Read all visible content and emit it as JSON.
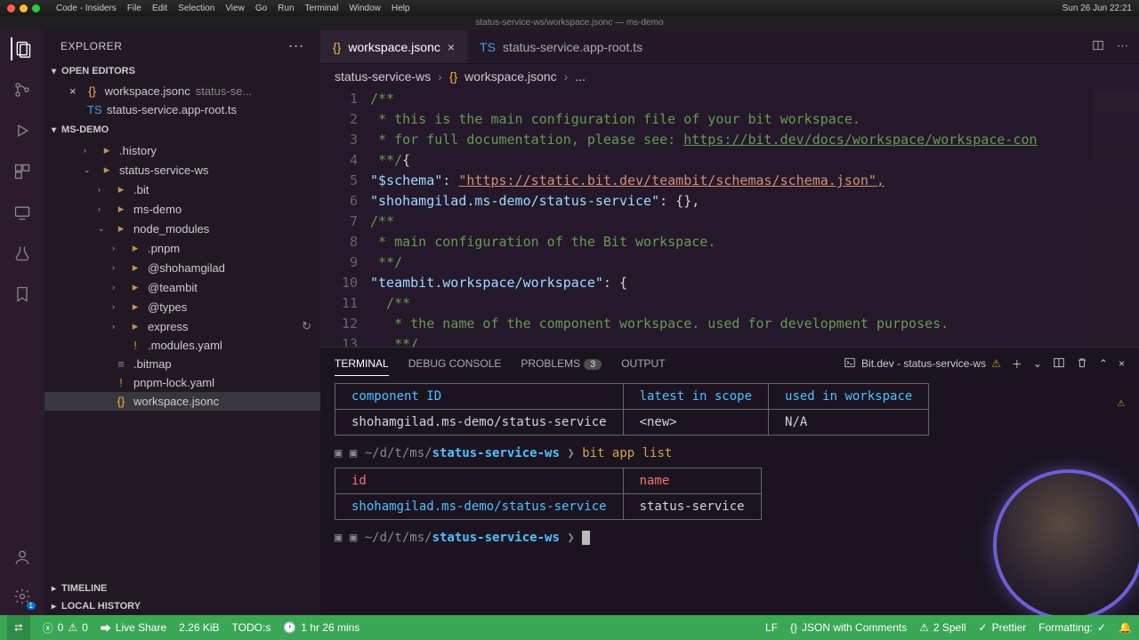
{
  "macos": {
    "app": "Code - Insiders",
    "menus": [
      "File",
      "Edit",
      "Selection",
      "View",
      "Go",
      "Run",
      "Terminal",
      "Window",
      "Help"
    ],
    "right": [
      "Sun 26 Jun 22:21"
    ]
  },
  "titlebar": "status-service-ws/workspace.jsonc — ms-demo",
  "sidebar": {
    "title": "EXPLORER",
    "open_editors": "OPEN EDITORS",
    "editors": [
      {
        "name": "workspace.jsonc",
        "hint": "status-se...",
        "modified": true,
        "icon": "json"
      },
      {
        "name": "status-service.app-root.ts",
        "hint": "",
        "modified": false,
        "icon": "ts"
      }
    ],
    "workspace": "MS-DEMO",
    "tree": [
      {
        "d": 2,
        "c": true,
        "icon": "folder",
        "label": ".history"
      },
      {
        "d": 2,
        "c": false,
        "icon": "folder",
        "label": "status-service-ws",
        "open": true
      },
      {
        "d": 3,
        "c": true,
        "icon": "folder",
        "label": ".bit"
      },
      {
        "d": 3,
        "c": true,
        "icon": "folder",
        "label": "ms-demo"
      },
      {
        "d": 3,
        "c": false,
        "icon": "folder",
        "label": "node_modules",
        "open": true
      },
      {
        "d": 4,
        "c": true,
        "icon": "folder",
        "label": ".pnpm"
      },
      {
        "d": 4,
        "c": true,
        "icon": "folder",
        "label": "@shohamgilad"
      },
      {
        "d": 4,
        "c": true,
        "icon": "folder",
        "label": "@teambit"
      },
      {
        "d": 4,
        "c": true,
        "icon": "folder",
        "label": "@types"
      },
      {
        "d": 4,
        "c": true,
        "icon": "folder",
        "label": "express",
        "refresh": true
      },
      {
        "d": 4,
        "c": null,
        "icon": "yaml",
        "label": ".modules.yaml",
        "warn": true
      },
      {
        "d": 3,
        "c": null,
        "icon": "bitmap",
        "label": ".bitmap"
      },
      {
        "d": 3,
        "c": null,
        "icon": "yaml",
        "label": "pnpm-lock.yaml",
        "warn": true
      },
      {
        "d": 3,
        "c": null,
        "icon": "json",
        "label": "workspace.jsonc",
        "sel": true
      }
    ],
    "timeline": "TIMELINE",
    "local_history": "LOCAL HISTORY"
  },
  "tabs": {
    "items": [
      {
        "icon": "json",
        "label": "workspace.jsonc",
        "active": true,
        "close": true
      },
      {
        "icon": "ts",
        "label": "status-service.app-root.ts",
        "active": false,
        "close": false
      }
    ]
  },
  "breadcrumb": {
    "parts": [
      "status-service-ws",
      "workspace.jsonc",
      "..."
    ],
    "icon_idx": 1
  },
  "code": {
    "lines": [
      "/**",
      " * this is the main configuration file of your bit workspace.",
      " * for full documentation, please see: https://bit.dev/docs/workspace/workspace-con",
      " **/{",
      "\"$schema\": \"https://static.bit.dev/teambit/schemas/schema.json\",",
      "\"shohamgilad.ms-demo/status-service\": {},",
      "/**",
      " * main configuration of the Bit workspace.",
      " **/",
      "\"teambit.workspace/workspace\": {",
      "  /**",
      "   * the name of the component workspace. used for development purposes.",
      "   **/"
    ]
  },
  "panel": {
    "tabs": [
      "TERMINAL",
      "DEBUG CONSOLE",
      "PROBLEMS",
      "OUTPUT"
    ],
    "problems_badge": "3",
    "term_name": "Bit.dev - status-service-ws",
    "table1": {
      "headers": [
        "component ID",
        "latest in scope",
        "used in workspace"
      ],
      "row": [
        "shohamgilad.ms-demo/status-service",
        "<new>",
        "N/A"
      ]
    },
    "prompt1": {
      "path": "~/d/t/ms/",
      "dir": "status-service-ws",
      "cmd": "bit app list"
    },
    "table2": {
      "headers": [
        "id",
        "name"
      ],
      "row": [
        "shohamgilad.ms-demo/status-service",
        "status-service"
      ]
    },
    "prompt2": {
      "path": "~/d/t/ms/",
      "dir": "status-service-ws"
    }
  },
  "statusbar": {
    "errors": "0",
    "warnings": "0",
    "liveshare": "Live Share",
    "size": "2.26 KiB",
    "todos": "TODO:s",
    "time": "1 hr 26 mins",
    "lf": "LF",
    "lang": "JSON with Comments",
    "spell": "2 Spell",
    "prettier": "Prettier",
    "formatting": "Formatting:"
  }
}
